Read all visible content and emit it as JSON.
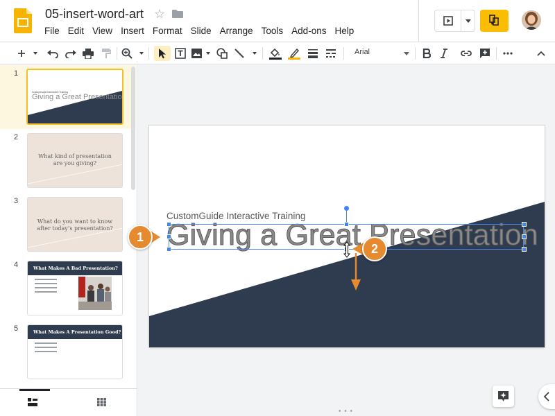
{
  "header": {
    "doc_title": "05-insert-word-art",
    "menu": [
      "File",
      "Edit",
      "View",
      "Insert",
      "Format",
      "Slide",
      "Arrange",
      "Tools",
      "Add-ons",
      "Help"
    ],
    "icons": [
      "slides-logo-icon",
      "star-icon",
      "folder-icon",
      "present-icon",
      "share-icon",
      "avatar"
    ]
  },
  "toolbar": {
    "font": "Arial",
    "icons": [
      "new-slide-icon",
      "undo-icon",
      "redo-icon",
      "print-icon",
      "paint-format-icon",
      "zoom-icon",
      "select-icon",
      "text-box-icon",
      "image-icon",
      "shape-icon",
      "line-icon",
      "fill-color-icon",
      "border-color-icon",
      "border-weight-icon",
      "border-dash-icon",
      "bold-icon",
      "italic-icon",
      "link-icon",
      "comment-icon",
      "more-icon",
      "collapse-icon"
    ]
  },
  "filmstrip": {
    "slides": [
      {
        "num": "1",
        "subtitle": "CustomGuide Interactive Training",
        "title": "Giving a Great Presentation"
      },
      {
        "num": "2",
        "text": "What kind of presentation are you giving?"
      },
      {
        "num": "3",
        "text": "What do you want to know after today’s presentation?"
      },
      {
        "num": "4",
        "header": "What Makes A Bad Presentation?"
      },
      {
        "num": "5",
        "header": "What Makes A Presentation Good?"
      }
    ]
  },
  "slide": {
    "subtitle": "CustomGuide Interactive Training",
    "wordart": "Giving a Great Presentation"
  },
  "callouts": [
    "1",
    "2"
  ],
  "colors": {
    "accent_yellow": "#fbbc04",
    "selection_blue": "#4285f4",
    "slide_dark": "#2f3b4e",
    "callout_orange": "#e58a2e"
  }
}
